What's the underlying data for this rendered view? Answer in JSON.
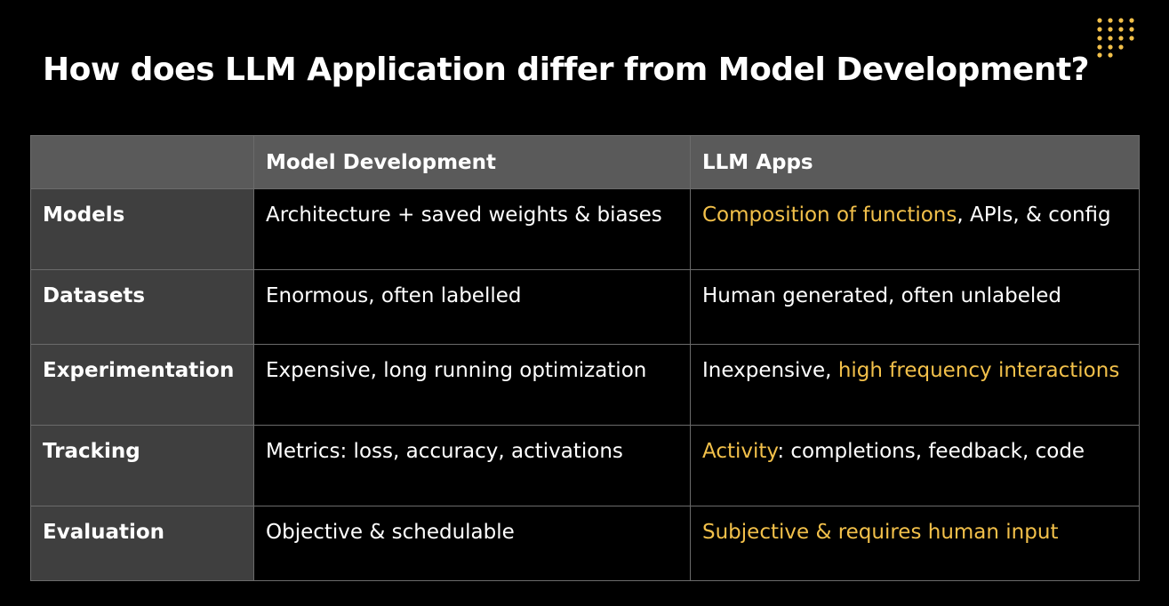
{
  "slide": {
    "title": "How does LLM Application differ  from Model Development?"
  },
  "logo": {
    "icon": "dotted-grid-logo-icon",
    "color": "#f2c04a"
  },
  "colors": {
    "highlight": "#f2c04a",
    "header_bg": "#5a5a5a",
    "row_label_bg": "#3f3f3f",
    "cell_bg": "#000000"
  },
  "table": {
    "headers": {
      "corner": "",
      "col1": "Model Development",
      "col2": "LLM Apps"
    },
    "rows": [
      {
        "label": "Models",
        "model_dev": "Architecture + saved weights & biases",
        "llm_hl": "Composition of functions",
        "llm_rest": ", APIs, & config"
      },
      {
        "label": "Datasets",
        "model_dev": "Enormous, often labelled",
        "llm_text": "Human generated, often unlabeled"
      },
      {
        "label": "Experimentation",
        "model_dev": "Expensive, long running optimization",
        "llm_pre": "Inexpensive, ",
        "llm_hl": "high frequency interactions"
      },
      {
        "label": "Tracking",
        "model_dev": "Metrics: loss, accuracy, activations",
        "llm_hl": "Activity",
        "llm_rest": ": completions, feedback, code"
      },
      {
        "label": "Evaluation",
        "model_dev": "Objective & schedulable",
        "llm_hl": "Subjective & requires human input"
      }
    ]
  }
}
